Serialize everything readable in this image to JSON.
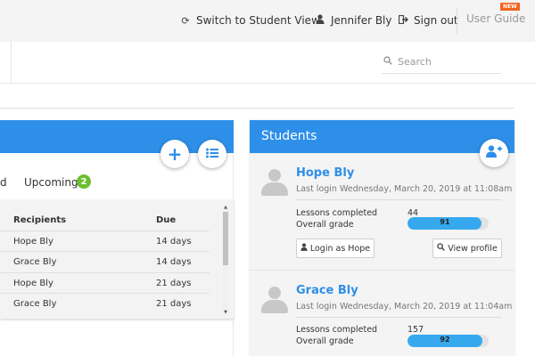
{
  "topbar": {
    "switch_label": "Switch to Student View",
    "user_name": "Jennifer Bly",
    "signout_label": "Sign out",
    "guide_label": "User Guide",
    "new_badge": "NEW"
  },
  "search": {
    "placeholder": "Search"
  },
  "tabs": {
    "partial_label": "d",
    "upcoming_label": "Upcoming",
    "upcoming_count": "2"
  },
  "table": {
    "headers": {
      "recipients": "Recipients",
      "due": "Due"
    },
    "rows": [
      {
        "recipient": "Hope Bly",
        "due": "14 days"
      },
      {
        "recipient": "Grace Bly",
        "due": "14 days"
      },
      {
        "recipient": "Hope Bly",
        "due": "21 days"
      },
      {
        "recipient": "Grace Bly",
        "due": "21 days"
      }
    ]
  },
  "students": {
    "title": "Students",
    "items": [
      {
        "name": "Hope Bly",
        "last_login": "Last login Wednesday, March 20, 2019 at 11:08am",
        "lessons_label": "Lessons completed",
        "lessons_value": "44",
        "grade_label": "Overall grade",
        "grade_value": "91",
        "grade_fraction": 0.91,
        "login_button": "Login as Hope",
        "profile_button": "View profile"
      },
      {
        "name": "Grace Bly",
        "last_login": "Last login Wednesday, March 20, 2019 at 11:04am",
        "lessons_label": "Lessons completed",
        "lessons_value": "157",
        "grade_label": "Overall grade",
        "grade_value": "92",
        "grade_fraction": 0.92
      }
    ]
  },
  "colors": {
    "accent": "#2e8fe9",
    "badge_new": "#f0651e",
    "badge_count": "#6cbf2f",
    "grade_fill": "#36a9ee"
  }
}
